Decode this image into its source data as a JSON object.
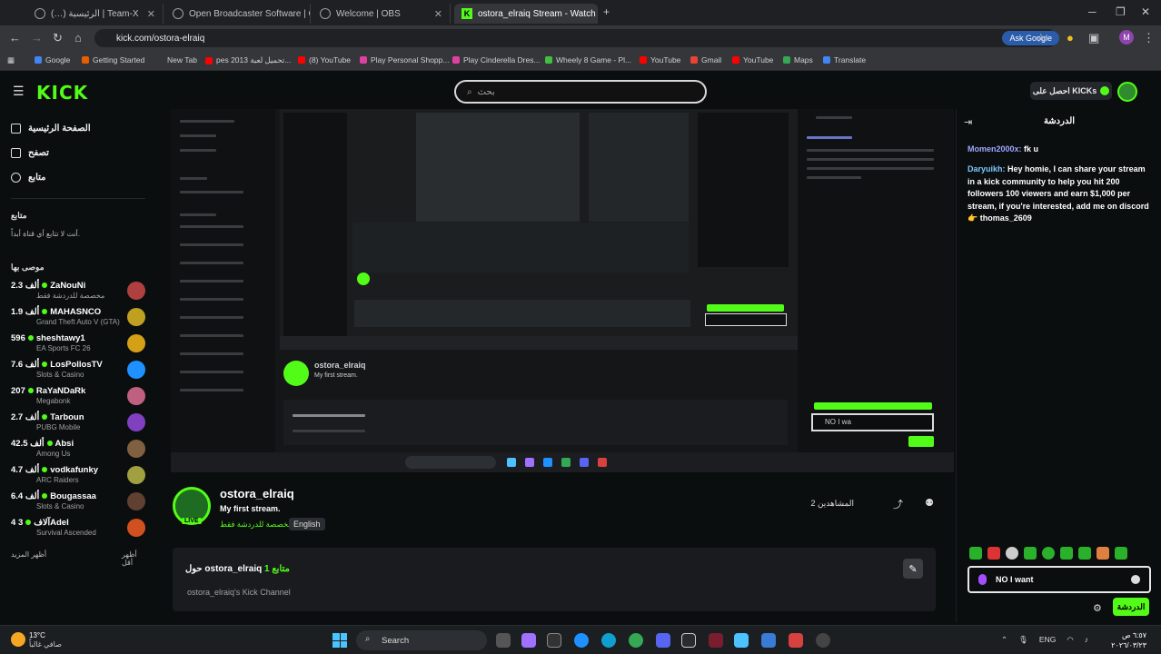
{
  "browser": {
    "tabs": [
      {
        "label": "(…) الرئيسية | Team-X"
      },
      {
        "label": "Open Broadcaster Software | O"
      },
      {
        "label": "Welcome | OBS"
      },
      {
        "label": "ostora_elraiq Stream - Watch L"
      }
    ],
    "url": "kick.com/ostora-elraiq",
    "ask_google": "Ask Google",
    "profile_initial": "M",
    "bookmarks": [
      {
        "label": "Google",
        "color": "#4285f4"
      },
      {
        "label": "Getting Started",
        "color": "#e66000"
      },
      {
        "label": "New Tab",
        "color": "#888888"
      },
      {
        "label": "pes 2013 تحميل لعبة...",
        "color": "#ff0000"
      },
      {
        "label": "(8) YouTube",
        "color": "#ff0000"
      },
      {
        "label": "Play Personal Shopp...",
        "color": "#e040a0"
      },
      {
        "label": "Play Cinderella Dres...",
        "color": "#e040a0"
      },
      {
        "label": "Wheely 8 Game - Pl...",
        "color": "#40c040"
      },
      {
        "label": "YouTube",
        "color": "#ff0000"
      },
      {
        "label": "Gmail",
        "color": "#ea4335"
      },
      {
        "label": "YouTube",
        "color": "#ff0000"
      },
      {
        "label": "Maps",
        "color": "#34a853"
      },
      {
        "label": "Translate",
        "color": "#4285f4"
      }
    ]
  },
  "kick": {
    "logo": "KICK",
    "search_placeholder": "بحث",
    "get_kicks": "احصل على KICKs",
    "nav": [
      {
        "label": "الصفحة الرئيسية"
      },
      {
        "label": "تصفح"
      },
      {
        "label": "متابع"
      }
    ],
    "following_heading": "متابع",
    "following_note": "أنت لا تتابع أي قناة أبداً.",
    "recommended_heading": "موصى بها",
    "channels": [
      {
        "count": "2.3 ألف",
        "name": "ZaNouNi",
        "game": "مخصصة للدردشة فقط",
        "color": "#b04040"
      },
      {
        "count": "1.9 ألف",
        "name": "MAHASNCO",
        "game": "Grand Theft Auto V (GTA)",
        "color": "#c0a020"
      },
      {
        "count": "596",
        "name": "sheshtawy1",
        "game": "EA Sports FC 26",
        "color": "#d4a017"
      },
      {
        "count": "7.6 ألف",
        "name": "LosPollosTV",
        "game": "Slots & Casino",
        "color": "#1e90ff"
      },
      {
        "count": "207",
        "name": "RaYaNDaRk",
        "game": "Megabonk",
        "color": "#c06080"
      },
      {
        "count": "2.7 ألف",
        "name": "Tarboun",
        "game": "PUBG Mobile",
        "color": "#8040c0"
      },
      {
        "count": "42.5 ألف",
        "name": "Absi",
        "game": "Among Us",
        "color": "#806040"
      },
      {
        "count": "4.7 ألف",
        "name": "vodkafunky",
        "game": "ARC Raiders",
        "color": "#a0a040"
      },
      {
        "count": "6.4 ألف",
        "name": "Bougassaa",
        "game": "Slots & Casino",
        "color": "#604030"
      },
      {
        "count": "4 آلاف",
        "name": "3Adel",
        "game": "Survival Ascended",
        "color": "#d05020"
      }
    ],
    "show_more": "أظهر المزيد",
    "show_less": "أظهر أقل"
  },
  "stream": {
    "streamer": "ostora_elraiq",
    "title": "My first stream.",
    "category": "مخصصة للدردشة فقط",
    "language": "English",
    "live_tag": "LIVE",
    "watchers": "2 المشاهدين",
    "about_prefix": "حول",
    "about_name": "ostora_elraiq",
    "followers": "1 متابع",
    "about_desc": "ostora_elraiq's Kick Channel"
  },
  "chat": {
    "title": "الدردشة",
    "messages": [
      {
        "user": "Momen2000x:",
        "text": " fk u"
      },
      {
        "user": "Daryuikh:",
        "text": " Hey homie, I can share your stream in a kick community to help you hit 200 followers 100 viewers and earn $1,000 per stream, if you're interested, add me on discord 👉 thomas_2609"
      }
    ],
    "input_value": "NO I want",
    "send_label": "الدردشة"
  },
  "taskbar": {
    "temp": "13°C",
    "weather": "صافي غالباً",
    "search": "Search",
    "lang": "ENG",
    "time": "٦:٥٧ ص",
    "date": "٢٠٢٦/٠٣/٢٣"
  },
  "colors": {
    "kick_green": "#53fc18",
    "background": "#0b0e0f"
  }
}
